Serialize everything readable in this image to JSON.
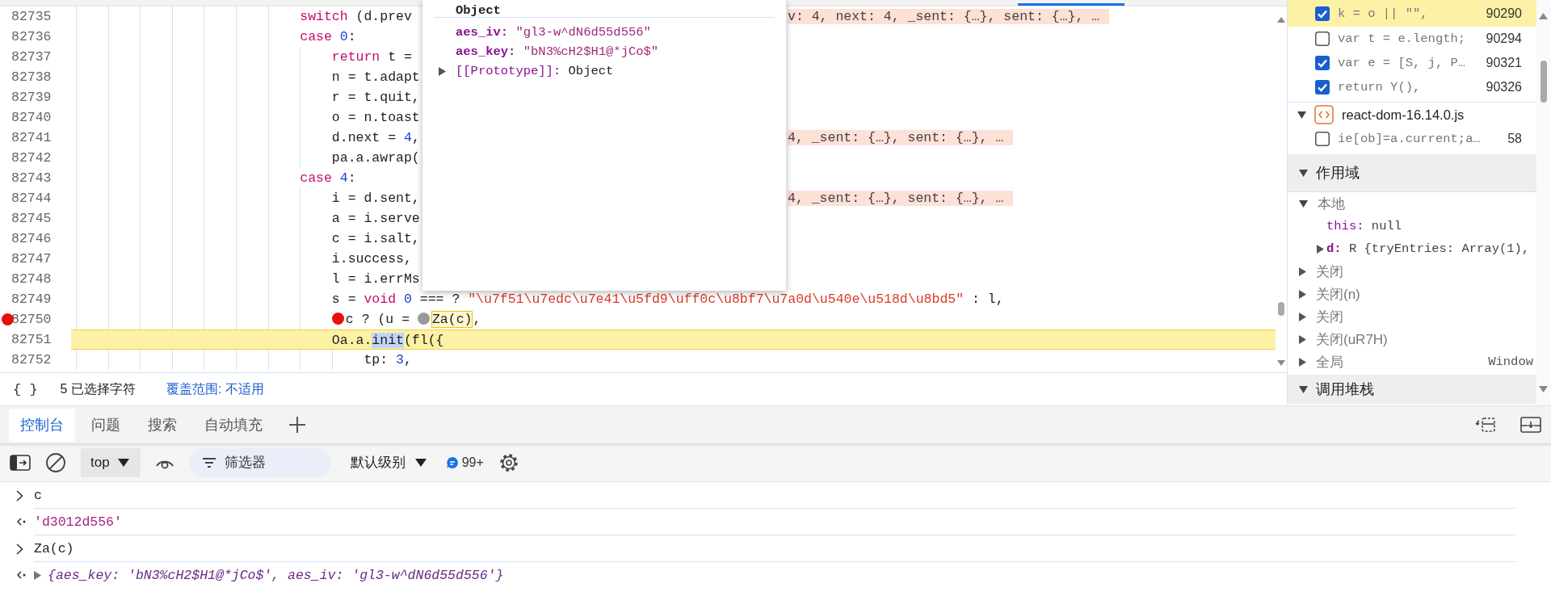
{
  "editor": {
    "lines": [
      {
        "number": "82735",
        "breakpoint": false,
        "current": false,
        "tokens": [
          {
            "kind": "kw",
            "text": "                            switch"
          },
          {
            "kind": "plain",
            "text": " (d.prev"
          }
        ],
        "inline_value": "v: 4, next: 4, _sent: {…}, sent: {…}, …"
      },
      {
        "number": "82736",
        "breakpoint": false,
        "current": false,
        "tokens": [
          {
            "kind": "kw",
            "text": "                            case"
          },
          {
            "kind": "num",
            "text": " 0"
          },
          {
            "kind": "plain",
            "text": ":"
          }
        ]
      },
      {
        "number": "82737",
        "breakpoint": false,
        "current": false,
        "tokens": [
          {
            "kind": "kw",
            "text": "                                return"
          },
          {
            "kind": "plain",
            "text": " t ="
          }
        ]
      },
      {
        "number": "82738",
        "breakpoint": false,
        "current": false,
        "tokens": [
          {
            "kind": "plain",
            "text": "                                n = t.adapt"
          }
        ]
      },
      {
        "number": "82739",
        "breakpoint": false,
        "current": false,
        "tokens": [
          {
            "kind": "plain",
            "text": "                                r = t.quit,"
          }
        ]
      },
      {
        "number": "82740",
        "breakpoint": false,
        "current": false,
        "tokens": [
          {
            "kind": "plain",
            "text": "                                o = n.toast"
          }
        ]
      },
      {
        "number": "82741",
        "breakpoint": false,
        "current": false,
        "tokens": [
          {
            "kind": "plain",
            "text": "                                d.next = "
          },
          {
            "kind": "num",
            "text": "4"
          },
          {
            "kind": "plain",
            "text": ","
          }
        ],
        "inline_value": "4, _sent: {…}, sent: {…}, …"
      },
      {
        "number": "82742",
        "breakpoint": false,
        "current": false,
        "tokens": [
          {
            "kind": "plain",
            "text": "                                pa.a.awrap("
          }
        ]
      },
      {
        "number": "82743",
        "breakpoint": false,
        "current": false,
        "tokens": [
          {
            "kind": "kw",
            "text": "                            case"
          },
          {
            "kind": "num",
            "text": " 4"
          },
          {
            "kind": "plain",
            "text": ":"
          }
        ]
      },
      {
        "number": "82744",
        "breakpoint": false,
        "current": false,
        "tokens": [
          {
            "kind": "plain",
            "text": "                                i = d.sent,"
          }
        ],
        "inline_value": "4, _sent: {…}, sent: {…}, …"
      },
      {
        "number": "82745",
        "breakpoint": false,
        "current": false,
        "tokens": [
          {
            "kind": "plain",
            "text": "                                a = i.serve"
          }
        ]
      },
      {
        "number": "82746",
        "breakpoint": false,
        "current": false,
        "tokens": [
          {
            "kind": "plain",
            "text": "                                c = i.salt,"
          }
        ]
      },
      {
        "number": "82747",
        "breakpoint": false,
        "current": false,
        "tokens": [
          {
            "kind": "plain",
            "text": "                                i.success,"
          }
        ]
      },
      {
        "number": "82748",
        "breakpoint": false,
        "current": false,
        "tokens": [
          {
            "kind": "plain",
            "text": "                                l = i.errMs"
          }
        ]
      },
      {
        "number": "82749",
        "breakpoint": false,
        "current": false,
        "tokens": [
          {
            "kind": "plain",
            "text": "                                s = "
          },
          {
            "kind": "kw",
            "text": "void"
          },
          {
            "kind": "num",
            "text": " 0"
          },
          {
            "kind": "plain",
            "text": " === ? "
          },
          {
            "kind": "str",
            "text": "\"\\u7f51\\u7edc\\u7e41\\u5fd9\\uff0c\\u8bf7\\u7a0d\\u540e\\u518d\\u8bd5\""
          },
          {
            "kind": "plain",
            "text": " : l,"
          }
        ]
      },
      {
        "number": "82750",
        "breakpoint": true,
        "current": false,
        "tokens": [
          {
            "kind": "breakpoint",
            "enabled": true
          },
          {
            "kind": "plain",
            "text": "                                c ? (u = "
          },
          {
            "kind": "breakpoint",
            "enabled": false
          },
          {
            "kind": "hover",
            "text": "Za(c)"
          },
          {
            "kind": "plain",
            "text": ","
          }
        ]
      },
      {
        "number": "82751",
        "breakpoint": false,
        "current": true,
        "tokens": [
          {
            "kind": "plain",
            "text": "                                Oa.a."
          },
          {
            "kind": "selected",
            "text": "init"
          },
          {
            "kind": "plain",
            "text": "(fl({"
          }
        ]
      },
      {
        "number": "82752",
        "breakpoint": false,
        "current": false,
        "tokens": [
          {
            "kind": "plain",
            "text": "                                    tp: "
          },
          {
            "kind": "num",
            "text": "3"
          },
          {
            "kind": "plain",
            "text": ","
          }
        ]
      }
    ]
  },
  "popover": {
    "title": "Object",
    "properties": [
      {
        "key": "aes_iv:",
        "value": "\"gl3-w^dN6d55d556\""
      },
      {
        "key": "aes_key:",
        "value": "\"bN3%cH2$H1@*jCo$\""
      }
    ],
    "prototype": {
      "key": "[[Prototype]]:",
      "value": "Object",
      "expanded": false
    }
  },
  "status_bar": {
    "format_button": "{ }",
    "selection": "5 已选择字符",
    "coverage": "覆盖范围: 不适用"
  },
  "breakpoints": {
    "items": [
      {
        "code": "k = o || \"\",",
        "line": "90290",
        "checked": true,
        "selected": true
      },
      {
        "code": "var t = e.length;",
        "line": "90294",
        "checked": false,
        "selected": false
      },
      {
        "code": "var e = [S, j, P…",
        "line": "90321",
        "checked": true,
        "selected": false
      },
      {
        "code": "return Y(),",
        "line": "90326",
        "checked": true,
        "selected": false
      }
    ],
    "files": [
      {
        "name": "react-dom-16.14.0.js",
        "expanded": true,
        "items": [
          {
            "code": "ie[ob]=a.current;a…",
            "line": "58",
            "checked": false,
            "selected": false
          }
        ]
      }
    ]
  },
  "scope": {
    "title": "作用域",
    "expanded": true,
    "groups": [
      {
        "label": "本地",
        "expanded": true,
        "children": [
          {
            "name": "this:",
            "value": "null",
            "expandable": false
          },
          {
            "name": "d:",
            "value": "R {tryEntries: Array(1),",
            "expandable": true
          }
        ]
      },
      {
        "label": "关闭",
        "expanded": false
      },
      {
        "label": "关闭(n)",
        "expanded": false
      },
      {
        "label": "关闭",
        "expanded": false
      },
      {
        "label": "关闭(uR7H)",
        "expanded": false
      },
      {
        "label": "全局",
        "value": "Window",
        "expanded": false
      }
    ]
  },
  "call_stack": {
    "title": "调用堆栈",
    "expanded": true
  },
  "drawer_tabs": [
    {
      "label": "控制台",
      "selected": true
    },
    {
      "label": "问题",
      "selected": false
    },
    {
      "label": "搜索",
      "selected": false
    },
    {
      "label": "自动填充",
      "selected": false
    }
  ],
  "console_toolbar": {
    "context": "top",
    "filter_placeholder": "筛选器",
    "level": "默认级别",
    "message_count": "99+"
  },
  "console": [
    {
      "kind": "input",
      "text": "c"
    },
    {
      "kind": "result",
      "text": "'d3012d556'"
    },
    {
      "kind": "input",
      "text": "Za(c)"
    },
    {
      "kind": "object",
      "text": "{aes_key: 'bN3%cH2$H1@*jCo$', aes_iv: 'gl3-w^dN6d55d556'}",
      "expanded": false
    }
  ]
}
